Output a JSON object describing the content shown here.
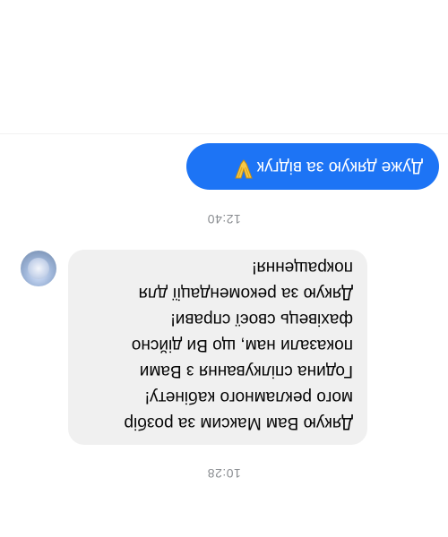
{
  "conversation": {
    "messages": [
      {
        "side": "incoming",
        "timestamp": "10:28",
        "lines": [
          "Дякую Вам Максим за розбір",
          "мого рекламного кабінету!",
          "Година спілкування з Вами",
          "показали нам, що Ви дійсно",
          "фахівець своєї справи!",
          "Дякую за рекомендації для",
          "покращення!"
        ]
      },
      {
        "side": "outgoing",
        "timestamp": "12:40",
        "text": "Дуже дякую за відгук",
        "emoji_name": "raised-hands-emoji",
        "colors": {
          "bubble": "#1d74f5",
          "text": "#ffffff"
        }
      }
    ],
    "colors": {
      "incoming_bubble": "#f0f0f0",
      "timestamp_text": "#8a8d91",
      "avatar": "#9fb6d9"
    }
  }
}
